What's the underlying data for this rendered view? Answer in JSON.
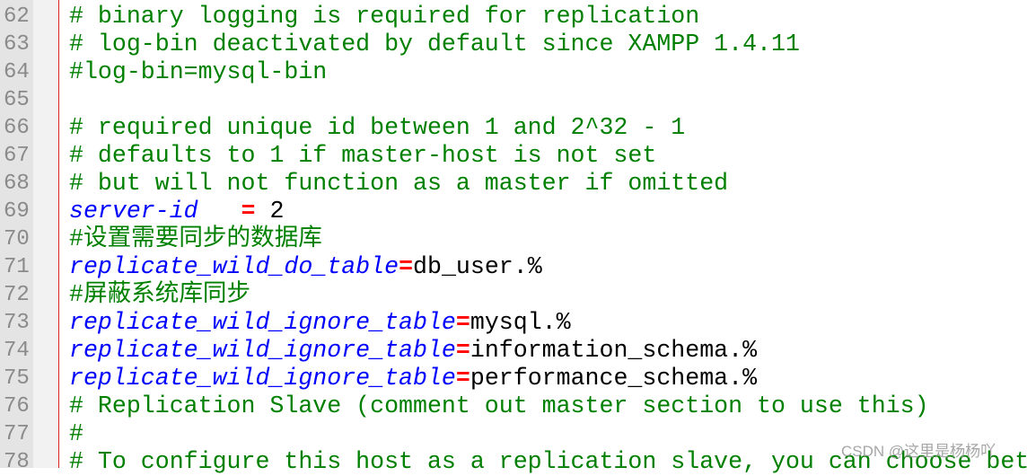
{
  "editor": {
    "colors": {
      "comment": "#008000",
      "keyword": "#0000ff",
      "operator": "#ff0000",
      "value": "#000000"
    },
    "lines": [
      {
        "num": "62",
        "tokens": [
          {
            "t": "c",
            "text": "# binary logging is required for replication"
          }
        ]
      },
      {
        "num": "63",
        "tokens": [
          {
            "t": "c",
            "text": "# log-bin deactivated by default since XAMPP 1.4.11"
          }
        ]
      },
      {
        "num": "64",
        "tokens": [
          {
            "t": "c",
            "text": "#log-bin=mysql-bin"
          }
        ]
      },
      {
        "num": "65",
        "tokens": []
      },
      {
        "num": "66",
        "tokens": [
          {
            "t": "c",
            "text": "# required unique id between 1 and 2^32 - 1"
          }
        ]
      },
      {
        "num": "67",
        "tokens": [
          {
            "t": "c",
            "text": "# defaults to 1 if master-host is not set"
          }
        ]
      },
      {
        "num": "68",
        "tokens": [
          {
            "t": "c",
            "text": "# but will not function as a master if omitted"
          }
        ]
      },
      {
        "num": "69",
        "tokens": [
          {
            "t": "k",
            "text": "server-id"
          },
          {
            "t": "v",
            "text": "   "
          },
          {
            "t": "o",
            "text": "="
          },
          {
            "t": "v",
            "text": " 2"
          }
        ]
      },
      {
        "num": "70",
        "tokens": [
          {
            "t": "c",
            "text": "#设置需要同步的数据库"
          }
        ]
      },
      {
        "num": "71",
        "tokens": [
          {
            "t": "k",
            "text": "replicate_wild_do_table"
          },
          {
            "t": "o",
            "text": "="
          },
          {
            "t": "v",
            "text": "db_user.%"
          }
        ]
      },
      {
        "num": "72",
        "tokens": [
          {
            "t": "c",
            "text": "#屏蔽系统库同步"
          }
        ]
      },
      {
        "num": "73",
        "tokens": [
          {
            "t": "k",
            "text": "replicate_wild_ignore_table"
          },
          {
            "t": "o",
            "text": "="
          },
          {
            "t": "v",
            "text": "mysql.%"
          }
        ]
      },
      {
        "num": "74",
        "tokens": [
          {
            "t": "k",
            "text": "replicate_wild_ignore_table"
          },
          {
            "t": "o",
            "text": "="
          },
          {
            "t": "v",
            "text": "information_schema.%"
          }
        ]
      },
      {
        "num": "75",
        "tokens": [
          {
            "t": "k",
            "text": "replicate_wild_ignore_table"
          },
          {
            "t": "o",
            "text": "="
          },
          {
            "t": "v",
            "text": "performance_schema.%"
          }
        ]
      },
      {
        "num": "76",
        "tokens": [
          {
            "t": "c",
            "text": "# Replication Slave (comment out master section to use this)"
          }
        ]
      },
      {
        "num": "77",
        "tokens": [
          {
            "t": "c",
            "text": "#"
          }
        ]
      },
      {
        "num": "78",
        "tokens": [
          {
            "t": "c",
            "text": "# To configure this host as a replication slave, you can choose bet"
          }
        ]
      }
    ]
  },
  "watermark": "CSDN @这里是杨杨吖"
}
